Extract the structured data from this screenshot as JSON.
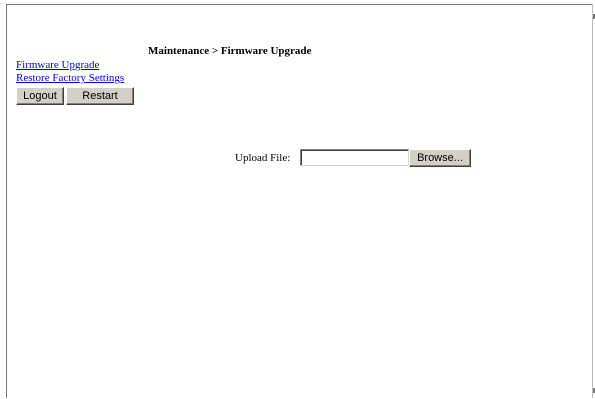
{
  "page": {
    "breadcrumb": "Maintenance > Firmware Upgrade"
  },
  "nav": {
    "links": [
      {
        "label": "Firmware Upgrade"
      },
      {
        "label": "Restore Factory Settings"
      }
    ],
    "logout_label": "Logout",
    "restart_label": "Restart"
  },
  "upload": {
    "label": "Upload File:",
    "value": "",
    "browse_label": "Browse..."
  },
  "colors": {
    "link": "#0000ee",
    "button_face": "#d4d0c8"
  }
}
